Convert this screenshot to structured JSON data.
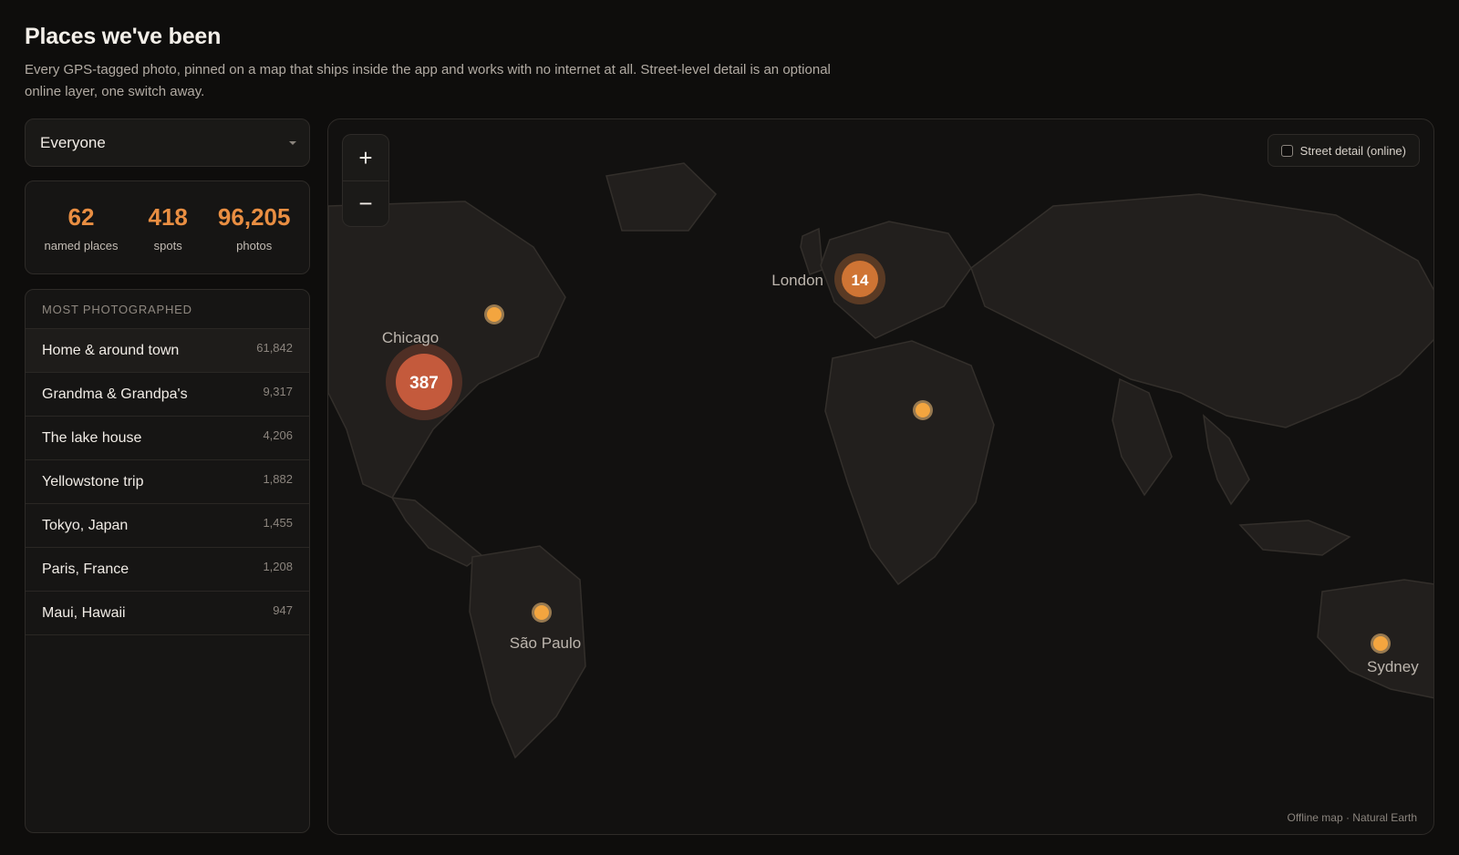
{
  "header": {
    "title": "Places we've been",
    "subtitle": "Every GPS-tagged photo, pinned on a map that ships inside the app and works with no internet at all. Street-level detail is an optional online layer, one switch away."
  },
  "filter": {
    "selected": "Everyone"
  },
  "stats": [
    {
      "value": "62",
      "label": "named places"
    },
    {
      "value": "418",
      "label": "spots"
    },
    {
      "value": "96,205",
      "label": "photos"
    }
  ],
  "most_photographed": {
    "heading": "MOST PHOTOGRAPHED",
    "items": [
      {
        "name": "Home & around town",
        "count": "61,842"
      },
      {
        "name": "Grandma & Grandpa's",
        "count": "9,317"
      },
      {
        "name": "The lake house",
        "count": "4,206"
      },
      {
        "name": "Yellowstone trip",
        "count": "1,882"
      },
      {
        "name": "Tokyo, Japan",
        "count": "1,455"
      },
      {
        "name": "Paris, France",
        "count": "1,208"
      },
      {
        "name": "Maui, Hawaii",
        "count": "947"
      }
    ]
  },
  "map": {
    "zoom_in_label": "+",
    "zoom_out_label": "−",
    "street_toggle_label": "Street detail (online)",
    "street_toggle_checked": false,
    "attribution": "Offline map · Natural Earth",
    "clusters": [
      {
        "label": "Chicago",
        "count": "387"
      },
      {
        "label": "London",
        "count": "14"
      }
    ],
    "city_labels": [
      "São Paulo",
      "Sydney"
    ],
    "colors": {
      "accent": "#e98e42",
      "cluster_large": "#c45a3c",
      "cluster_small": "#cf7434",
      "pin": "#f3a53f"
    }
  }
}
